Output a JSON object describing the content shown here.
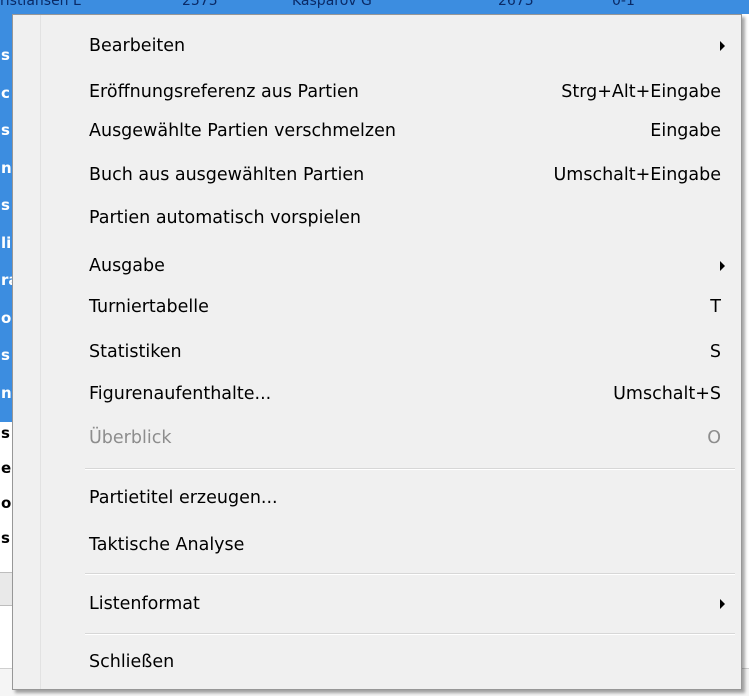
{
  "background": {
    "header_fragments": [
      "ristiansen L",
      "2575",
      "Kasparov G",
      "2675",
      "0-1"
    ],
    "left_letters": [
      "s",
      "c",
      "s",
      "n",
      "s",
      "li",
      "ra",
      "o",
      "s",
      "n",
      "s",
      "e",
      "o",
      "s"
    ]
  },
  "menu": {
    "items": [
      {
        "label": "Bearbeiten",
        "shortcut": "",
        "submenu": true,
        "disabled": false
      },
      {
        "label": "Eröffnungsreferenz aus Partien",
        "shortcut": "Strg+Alt+Eingabe",
        "submenu": false,
        "disabled": false
      },
      {
        "label": "Ausgewählte Partien verschmelzen",
        "shortcut": "Eingabe",
        "submenu": false,
        "disabled": false
      },
      {
        "label": "Buch aus ausgewählten Partien",
        "shortcut": "Umschalt+Eingabe",
        "submenu": false,
        "disabled": false
      },
      {
        "label": "Partien automatisch vorspielen",
        "shortcut": "",
        "submenu": false,
        "disabled": false
      },
      {
        "label": "Ausgabe",
        "shortcut": "",
        "submenu": true,
        "disabled": false
      },
      {
        "label": "Turniertabelle",
        "shortcut": "T",
        "submenu": false,
        "disabled": false
      },
      {
        "label": "Statistiken",
        "shortcut": "S",
        "submenu": false,
        "disabled": false
      },
      {
        "label": "Figurenaufenthalte...",
        "shortcut": "Umschalt+S",
        "submenu": false,
        "disabled": false
      },
      {
        "label": "Überblick",
        "shortcut": "O",
        "submenu": false,
        "disabled": true
      },
      {
        "label": "Partietitel erzeugen...",
        "shortcut": "",
        "submenu": false,
        "disabled": false
      },
      {
        "label": "Taktische Analyse",
        "shortcut": "",
        "submenu": false,
        "disabled": false
      },
      {
        "label": "Listenformat",
        "shortcut": "",
        "submenu": true,
        "disabled": false
      },
      {
        "label": "Schließen",
        "shortcut": "",
        "submenu": false,
        "disabled": false
      }
    ]
  },
  "colors": {
    "menu_bg": "#f0f0f0",
    "selection_blue": "#3c8de0",
    "disabled_text": "#8d8d8d"
  }
}
